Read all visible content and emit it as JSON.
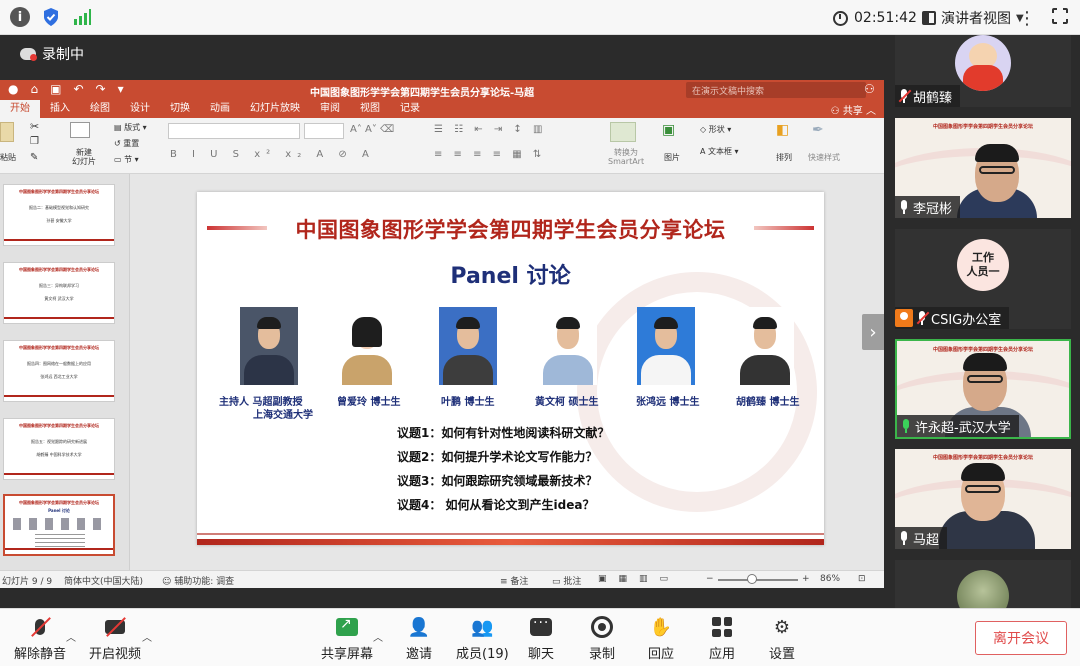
{
  "topbar": {
    "time": "02:51:42",
    "view_mode": "演讲者视图"
  },
  "recording": {
    "label": "录制中"
  },
  "ppt": {
    "doc_title": "中国图象图形学学会第四期学生会员分享论坛-马超",
    "search_placeholder": "在演示文稿中搜索",
    "share_label": "共享",
    "tabs": [
      "开始",
      "插入",
      "绘图",
      "设计",
      "切换",
      "动画",
      "幻灯片放映",
      "审阅",
      "视图",
      "记录"
    ],
    "ribbon": {
      "paste": "粘贴",
      "new_slide": "新建\n幻灯片",
      "layout": "版式",
      "reset": "重置",
      "section": "节",
      "smartart": "转换为\nSmartArt",
      "picture": "图片",
      "shape": "形状",
      "textbox": "文本框",
      "arrange": "排列",
      "quick_style": "快速样式"
    },
    "thumbnails": [
      {
        "title": "中国图象图形学学会第四期学生会员分享论坛",
        "lines": [
          "报告二：基础模型视觉和认知研究",
          "孙甚   安徽大学"
        ]
      },
      {
        "title": "中国图象图形学学会第四期学生会员分享论坛",
        "lines": [
          "报告三：异构联邦学习",
          "黄文柯   武汉大学"
        ]
      },
      {
        "title": "中国图象图形学学会第四期学生会员分享论坛",
        "lines": [
          "报告四：图网络在一般数据上的应用",
          "张鸿远   西北工业大学"
        ]
      },
      {
        "title": "中国图象图形学学会第四期学生会员分享论坛",
        "lines": [
          "报告五：视觉跟踪的研究新进展",
          "胡鹤臻   中国科学技术大学"
        ]
      },
      {
        "title": "中国图象图形学学会第四期学生会员分享论坛",
        "lines": [
          "Panel 讨论"
        ]
      }
    ],
    "slide": {
      "title": "中国图象图形学学会第四期学生会员分享论坛",
      "subtitle": "Panel 讨论",
      "host_line1": "主持人  马超副教授",
      "host_line2": "上海交通大学",
      "panelists": [
        "曾爱玲 博士生",
        "叶鹏 博士生",
        "黄文柯 硕士生",
        "张鸿远 博士生",
        "胡鹤臻 博士生"
      ],
      "topics": [
        "议题1：如何有针对性地阅读科研文献？",
        "议题2：如何提升学术论文写作能力？",
        "议题3：如何跟踪研究领域最新技术？",
        "议题4： 如何从看论文到产生idea？"
      ]
    },
    "status": {
      "slide_pos": "幻灯片 9 / 9",
      "lang": "简体中文(中国大陆)",
      "accessibility": "辅助功能: 调查",
      "notes": "备注",
      "comments": "批注",
      "zoom": "86%"
    }
  },
  "participants": [
    {
      "name": "胡鹤臻",
      "mic": "muted"
    },
    {
      "name": "李冠彬",
      "mic": "on"
    },
    {
      "name": "CSIG办公室",
      "mic": "muted",
      "avatar_text": "工作\n人员一"
    },
    {
      "name": "许永超-武汉大学",
      "mic": "active"
    },
    {
      "name": "马超",
      "mic": "on"
    }
  ],
  "toolbar": {
    "mute": "解除静音",
    "video": "开启视频",
    "share": "共享屏幕",
    "invite": "邀请",
    "members": "成员(19)",
    "chat": "聊天",
    "record": "录制",
    "react": "回应",
    "apps": "应用",
    "settings": "设置",
    "leave": "离开会议"
  },
  "colors": {
    "ppt_accent": "#c84b31",
    "slide_title": "#b1261c",
    "slide_subtitle": "#1e2f78",
    "active_speaker": "#3bb54a",
    "leave": "#e04b4b"
  }
}
